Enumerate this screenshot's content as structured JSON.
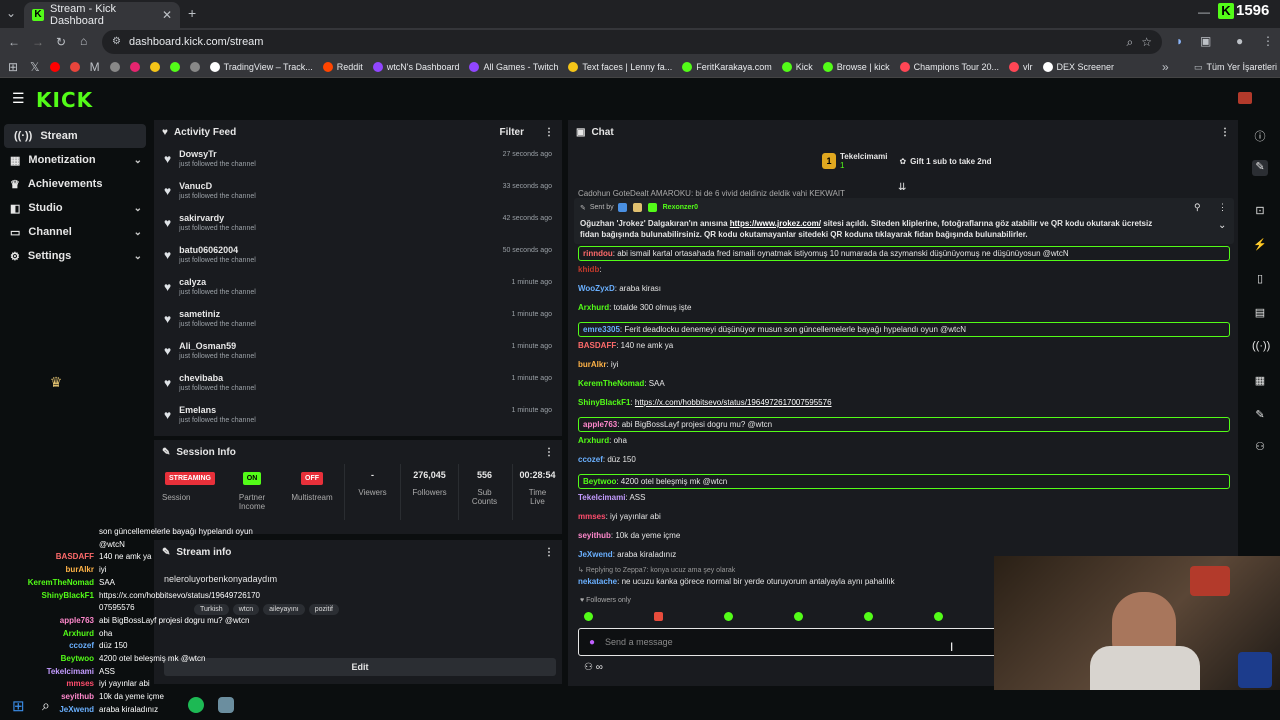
{
  "browser": {
    "tab_title": "Stream - Kick Dashboard",
    "url": "dashboard.kick.com/stream",
    "bookmarks": [
      "TradingView – Track...",
      "Reddit",
      "wtcN's Dashboard",
      "All Games - Twitch",
      "Text faces | Lenny fa...",
      "FeritKarakaya.com",
      "Kick",
      "Browse | kick",
      "Champions Tour 20...",
      "vlr",
      "DEX Screener"
    ],
    "all_bookmarks": "Tüm Yer İşaretleri",
    "overlay_count": "1596"
  },
  "app": {
    "logo": "KICK"
  },
  "sidebar": {
    "items": [
      {
        "label": "Stream"
      },
      {
        "label": "Monetization"
      },
      {
        "label": "Achievements"
      },
      {
        "label": "Studio"
      },
      {
        "label": "Channel"
      },
      {
        "label": "Settings"
      }
    ]
  },
  "activity": {
    "title": "Activity Feed",
    "filter": "Filter",
    "items": [
      {
        "name": "DowsyTr",
        "sub": "just followed the channel",
        "time": "27 seconds ago"
      },
      {
        "name": "VanucD",
        "sub": "just followed the channel",
        "time": "33 seconds ago"
      },
      {
        "name": "sakirvardy",
        "sub": "just followed the channel",
        "time": "42 seconds ago"
      },
      {
        "name": "batu06062004",
        "sub": "just followed the channel",
        "time": "50 seconds ago"
      },
      {
        "name": "calyza",
        "sub": "just followed the channel",
        "time": "1 minute ago"
      },
      {
        "name": "sametiniz",
        "sub": "just followed the channel",
        "time": "1 minute ago"
      },
      {
        "name": "Ali_Osman59",
        "sub": "just followed the channel",
        "time": "1 minute ago"
      },
      {
        "name": "chevibaba",
        "sub": "just followed the channel",
        "time": "1 minute ago"
      },
      {
        "name": "Emelans",
        "sub": "just followed the channel",
        "time": "1 minute ago"
      }
    ]
  },
  "session": {
    "title": "Session Info",
    "streaming": "STREAMING",
    "session_label": "Session",
    "on": "ON",
    "partner_label1": "Partner",
    "partner_label2": "Income",
    "off": "OFF",
    "multistream_label": "Multistream",
    "viewers_val": "-",
    "viewers_label": "Viewers",
    "followers_val": "276,045",
    "followers_label": "Followers",
    "subs_val": "556",
    "subs_label1": "Sub",
    "subs_label2": "Counts",
    "time_val": "00:28:54",
    "time_label1": "Time",
    "time_label2": "Live"
  },
  "stream_info": {
    "title": "Stream info",
    "stream_title": "neleroluyorbenkonyadaydım",
    "tags": [
      "Turkish",
      "wtcn",
      "aileyayını",
      "pozitif"
    ],
    "edit": "Edit"
  },
  "chat": {
    "title": "Chat",
    "gifter": "Tekelcimami",
    "gifter_count": "1",
    "gift_text": "Gift 1 sub to take 2nd",
    "pinned_by_label": "Sent by",
    "pinned_by": "Rexonzer0",
    "pinned_msg1": "Oğuzhan 'Jrokez' Dalgakıran'ın anısına ",
    "pinned_link": "https://www.jrokez.com/",
    "pinned_msg2": " sitesi açıldı. Siteden kliplerine, fotoğraflarına göz atabilir ve QR kodu okutarak ücretsiz",
    "pinned_msg3": "fidan bağışında bulunabilirsiniz. QR kodu okutamayanlar sitedeki QR koduna tıklayarak fidan bağışında bulunabilirler.",
    "top_partial": "Cadohun  GoteDealt  AMAROKU: bi de 6 vivid deldiniz  deldik vahi KEKWAIT",
    "messages": [
      {
        "user": "rinndou",
        "text": "abi ismail kartal ortasahada fred ismaili oynatmak istiyomuş 10 numarada da szymanski düşünüyomuş ne düşünüyosun @wtcN",
        "color": "#ff6b6b",
        "hl": true
      },
      {
        "user": "khidb",
        "text": "",
        "color": "#c0392b",
        "hl": false
      },
      {
        "user": "WooZyxD",
        "text": "araba kirası",
        "color": "#6ab0ff",
        "hl": false
      },
      {
        "user": "Arxhurd",
        "text": "totalde 300 olmuş işte",
        "color": "#53fc18",
        "hl": false
      },
      {
        "user": "emre3305",
        "text": "Ferit deadlocku denemeyi düşünüyor musun son güncellemelerle bayağı hypelandı oyun @wtcN",
        "color": "#6ab0ff",
        "hl": true
      },
      {
        "user": "BASDAFF",
        "text": "140 ne amk ya",
        "color": "#ff6b6b",
        "hl": false
      },
      {
        "user": "burAlkr",
        "text": "iyi",
        "color": "#ffb347",
        "hl": false
      },
      {
        "user": "KeremTheNomad",
        "text": "SAA",
        "color": "#53fc18",
        "hl": false
      },
      {
        "user": "ShinyBlackF1",
        "text": "https://x.com/hobbitsevo/status/1964972617007595576",
        "color": "#53fc18",
        "hl": false,
        "link": true
      },
      {
        "user": "apple763",
        "text": "abi BigBossLayf projesi dogru mu? @wtcn",
        "color": "#ff88cc",
        "hl": true
      },
      {
        "user": "Arxhurd",
        "text": "oha",
        "color": "#53fc18",
        "hl": false
      },
      {
        "user": "ccozef",
        "text": "düz 150",
        "color": "#6ab0ff",
        "hl": false
      },
      {
        "user": "Beytwoo",
        "text": "4200 otel beleşmiş mk @wtcn",
        "color": "#53fc18",
        "hl": true
      },
      {
        "user": "Tekelcimami",
        "text": "ASS",
        "color": "#c39bff",
        "hl": false
      },
      {
        "user": "mmses",
        "text": "iyi yayınlar abi",
        "color": "#ff4d6d",
        "hl": false
      },
      {
        "user": "seyithub",
        "text": "10k da yeme içme",
        "color": "#ff88cc",
        "hl": false
      },
      {
        "user": "JeXwend",
        "text": "araba kiraladınız",
        "color": "#6ab0ff",
        "hl": false
      }
    ],
    "reply_label": "Replying to Zeppa7: konya ucuz ama şey olarak",
    "reply_user": "nekatache",
    "reply_text": "ne ucuzu kanka görece normal bir yerde oturuyorum antalyayla aynı pahalılık",
    "followers_only": "Followers only",
    "placeholder": "Send a message",
    "infinity": "∞"
  },
  "overlay_chat": [
    {
      "name": "",
      "text": "son güncellemelerle bayağı hypelandı oyun"
    },
    {
      "name": "",
      "text": "@wtcN"
    },
    {
      "name": "BASDAFF",
      "text": "140 ne amk ya",
      "color": "#ff6b6b"
    },
    {
      "name": "burAlkr",
      "text": "iyi",
      "color": "#ffb347"
    },
    {
      "name": "KeremTheNomad",
      "text": "SAA",
      "color": "#53fc18"
    },
    {
      "name": "ShinyBlackF1",
      "text": "https://x.com/hobbitsevo/status/19649726170",
      "color": "#53fc18"
    },
    {
      "name": "",
      "text": "07595576"
    },
    {
      "name": "apple763",
      "text": "abi BigBossLayf projesi dogru mu? @wtcn",
      "color": "#ff88cc"
    },
    {
      "name": "Arxhurd",
      "text": "oha",
      "color": "#53fc18"
    },
    {
      "name": "ccozef",
      "text": "düz 150",
      "color": "#6ab0ff"
    },
    {
      "name": "Beytwoo",
      "text": "4200 otel beleşmiş mk @wtcn",
      "color": "#53fc18"
    },
    {
      "name": "Tekelcimami",
      "text": "ASS",
      "color": "#c39bff"
    },
    {
      "name": "mmses",
      "text": "iyi yayınlar abi",
      "color": "#ff4d6d"
    },
    {
      "name": "seyithub",
      "text": "10k da yeme içme",
      "color": "#ff88cc"
    },
    {
      "name": "JeXwend",
      "text": "araba kiraladınız",
      "color": "#6ab0ff"
    }
  ],
  "colors": {
    "accent": "#53fc18",
    "streaming": "#e8303a",
    "panel": "#191b1f"
  }
}
